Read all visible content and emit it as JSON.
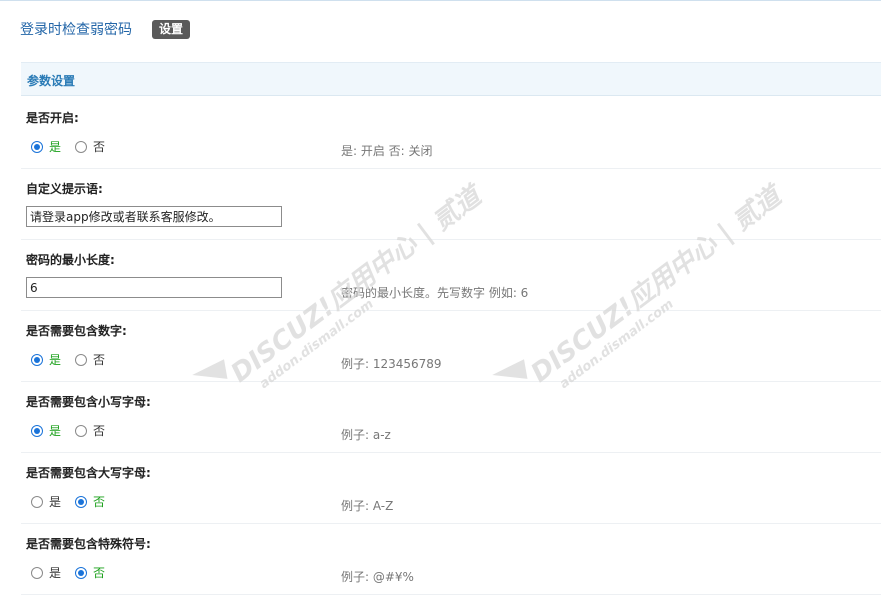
{
  "header": {
    "title": "登录时检查弱密码",
    "tag_button": "设置"
  },
  "section": {
    "title": "参数设置"
  },
  "watermark": {
    "brand": "DISCUZ!应用中心 | 贰道",
    "domain": "addon.dismall.com"
  },
  "rows": [
    {
      "label": "是否开启:",
      "options": [
        "是",
        "否"
      ],
      "selected": "是",
      "comment": "是: 开启 否: 关闭"
    },
    {
      "label": "自定义提示语:",
      "value": "请登录app修改或者联系客服修改。"
    },
    {
      "label": "密码的最小长度:",
      "value": "6",
      "comment": "密码的最小长度。先写数字 例如: 6"
    },
    {
      "label": "是否需要包含数字:",
      "options": [
        "是",
        "否"
      ],
      "selected": "是",
      "comment": "例子: 123456789"
    },
    {
      "label": "是否需要包含小写字母:",
      "options": [
        "是",
        "否"
      ],
      "selected": "是",
      "comment": "例子: a-z"
    },
    {
      "label": "是否需要包含大写字母:",
      "options": [
        "是",
        "否"
      ],
      "selected": "否",
      "comment": "例子: A-Z"
    },
    {
      "label": "是否需要包含特殊符号:",
      "options": [
        "是",
        "否"
      ],
      "selected": "否",
      "comment": "例子: @#¥%"
    }
  ]
}
